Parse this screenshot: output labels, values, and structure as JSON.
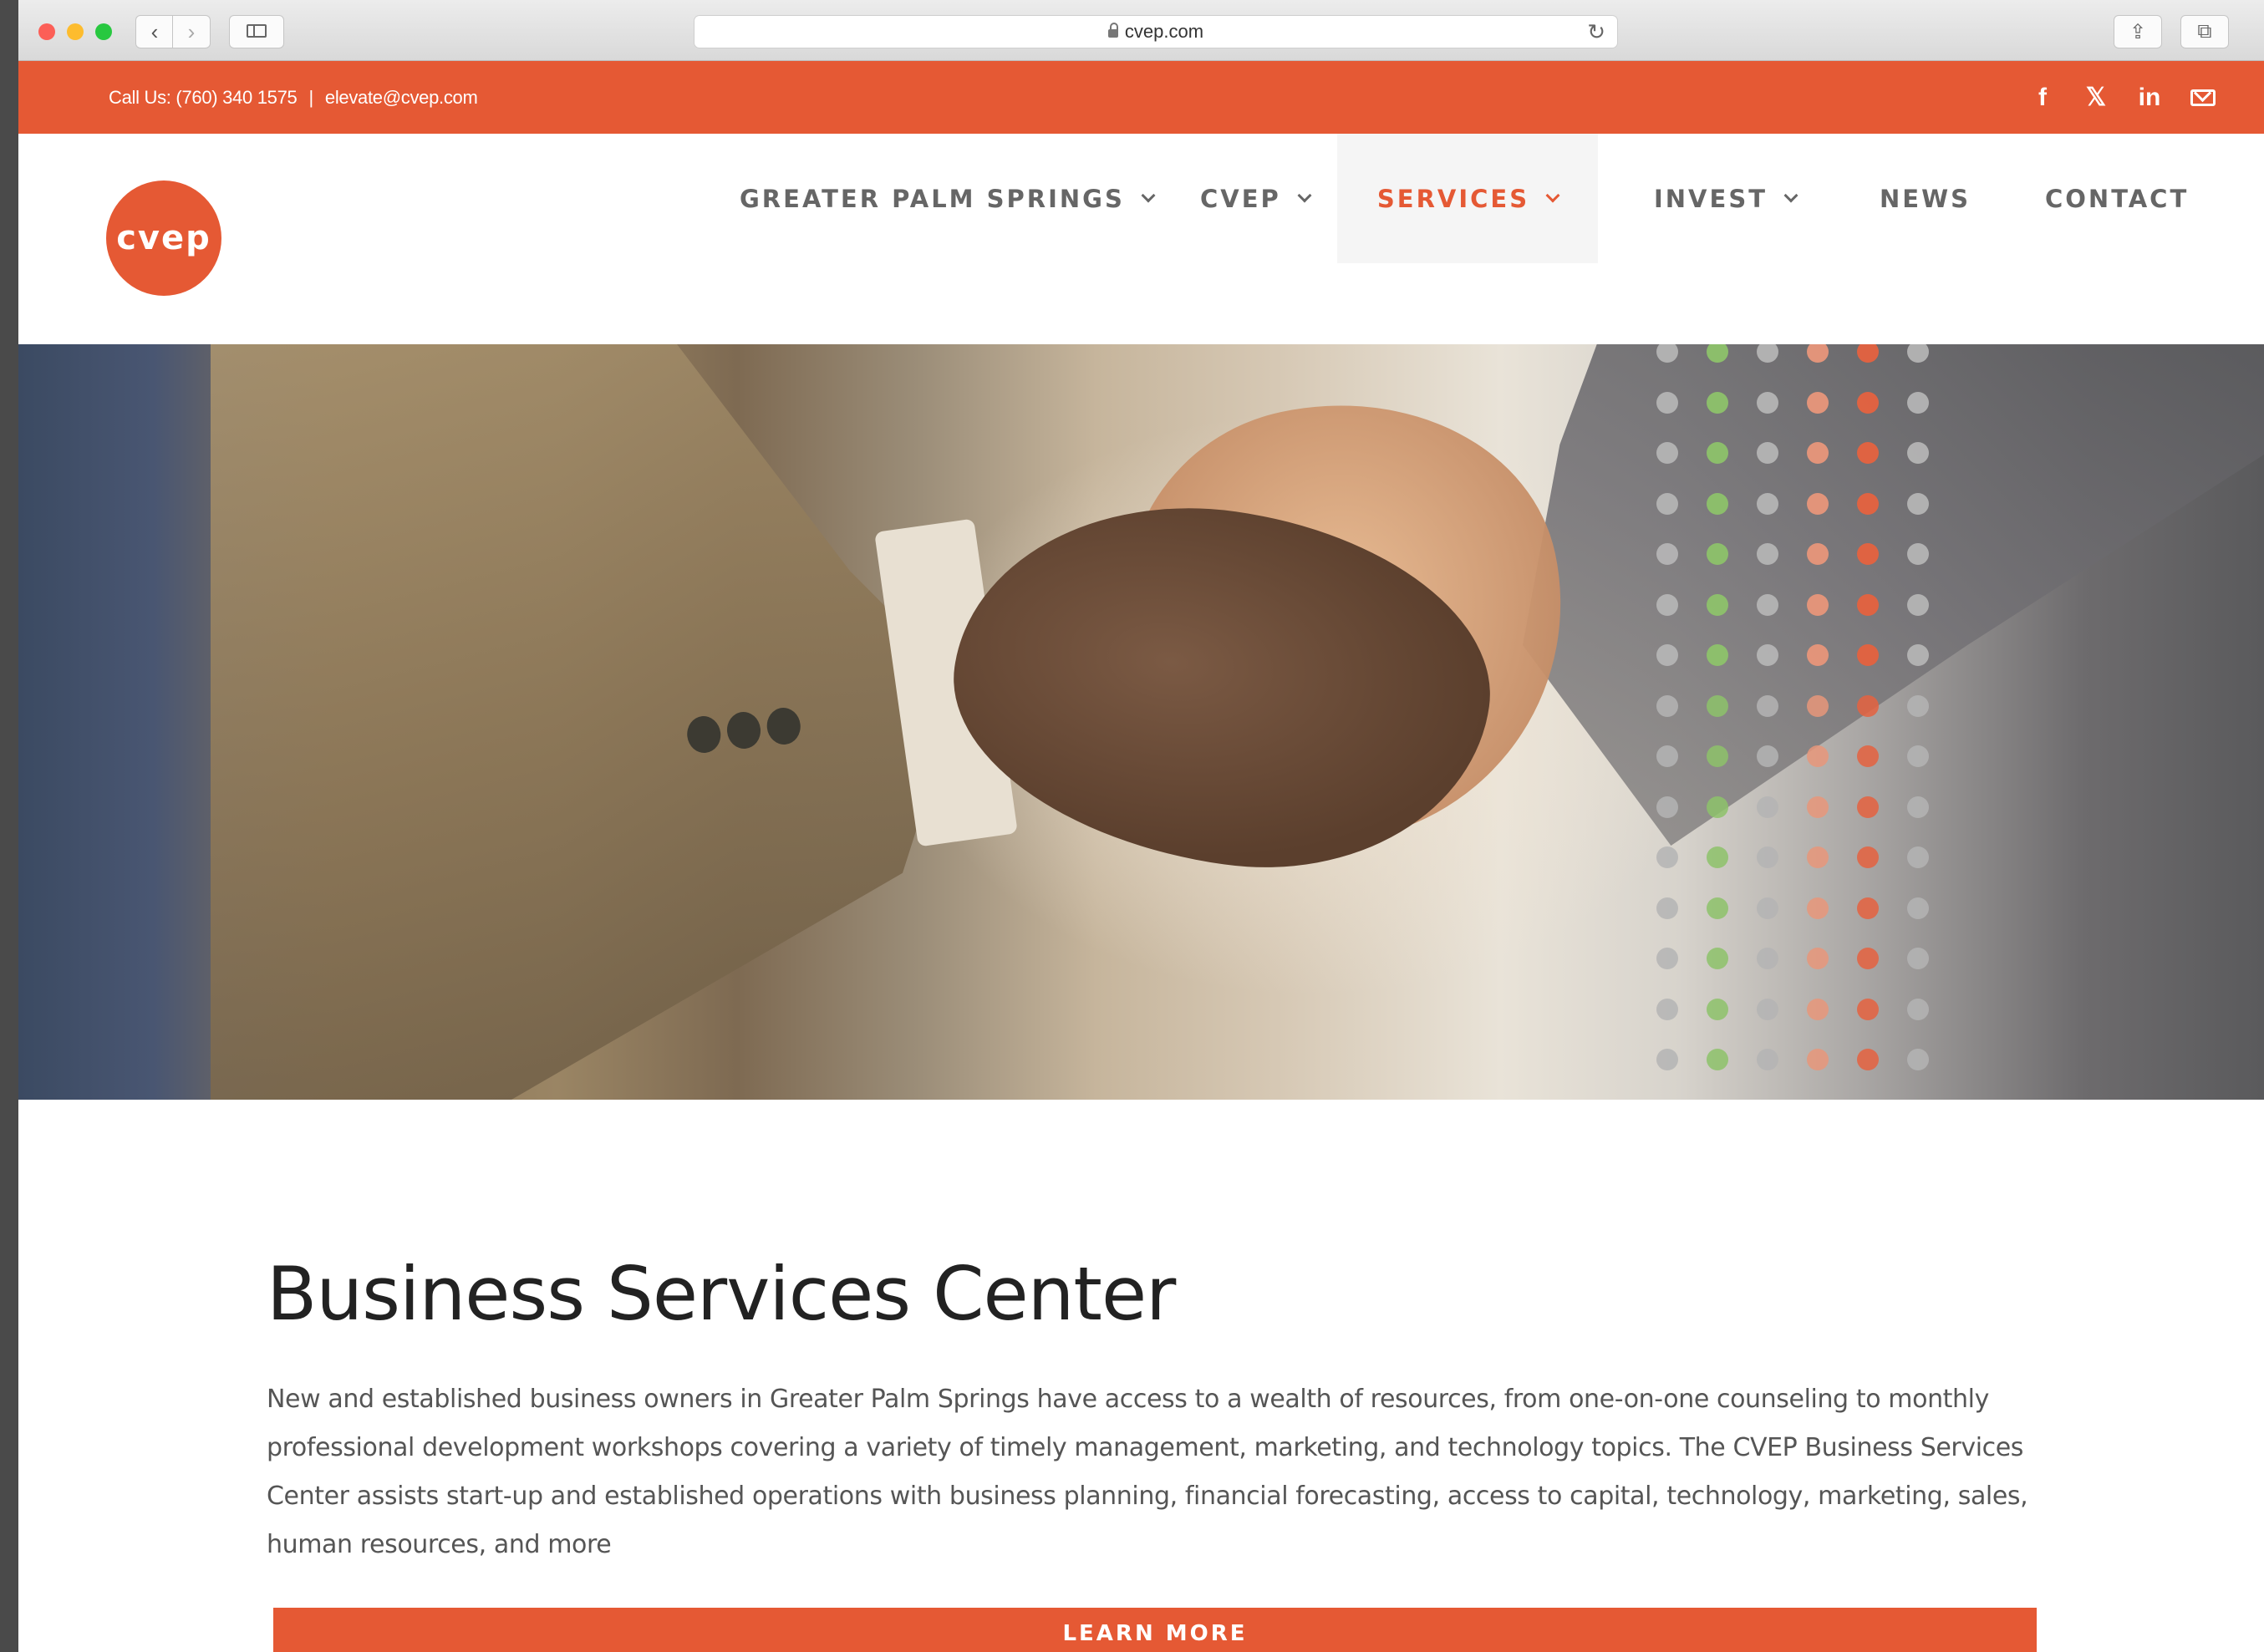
{
  "browser": {
    "url": "cvep.com"
  },
  "topbar": {
    "phone": "Call Us: (760) 340 1575",
    "separator": "|",
    "email": "elevate@cvep.com",
    "social": [
      {
        "name": "facebook-icon",
        "glyph": "f"
      },
      {
        "name": "twitter-icon",
        "glyph": "🐦"
      },
      {
        "name": "linkedin-icon",
        "glyph": "in"
      },
      {
        "name": "mail-icon",
        "glyph": ""
      }
    ]
  },
  "header": {
    "logo_text": "cvep",
    "nav": [
      {
        "label": "GREATER PALM SPRINGS",
        "dropdown": true
      },
      {
        "label": "CVEP",
        "dropdown": true
      },
      {
        "label": "SERVICES",
        "dropdown": true,
        "active": true
      },
      {
        "label": "INVEST",
        "dropdown": true
      },
      {
        "label": "NEWS",
        "dropdown": false
      },
      {
        "label": "CONTACT",
        "dropdown": false
      }
    ]
  },
  "hero": {
    "dot_colors": [
      "#b4b4b4",
      "#8dc26a",
      "#b4b4b4",
      "#e8967a",
      "#e5623f",
      "#b4b4b4"
    ]
  },
  "main": {
    "title": "Business Services Center",
    "description": "New and established business owners in Greater Palm Springs have access to a wealth of resources, from one-on-one counseling to monthly professional development workshops covering a variety of timely management, marketing, and technology topics. The CVEP Business Services Center assists start-up and established operations with business planning, financial forecasting, access to capital, technology, marketing, sales, human resources, and more",
    "cta_label": "LEARN MORE"
  },
  "colors": {
    "brand": "#e55934",
    "nav_text": "#666666",
    "title_text": "#222222"
  }
}
